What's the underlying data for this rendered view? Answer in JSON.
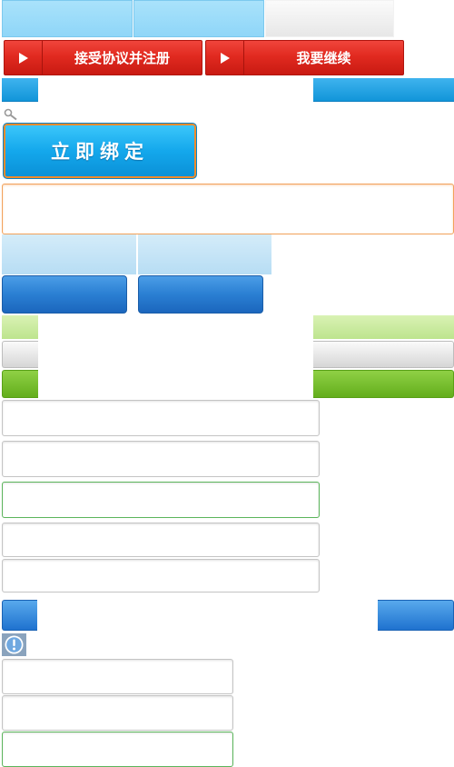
{
  "register": {
    "accept_label": "接受协议并注册",
    "continue_label": "我要继续"
  },
  "bind": {
    "label": "立即绑定"
  },
  "icons": {
    "search": "search-icon",
    "play": "play-arrow-icon",
    "info": "info-icon"
  },
  "colors": {
    "red_button": "#e12a20",
    "bind_button": "#14a8ec",
    "orange_border": "#f2a25c",
    "green_button": "#63ae1c",
    "blue_button": "#2a7fd3"
  }
}
